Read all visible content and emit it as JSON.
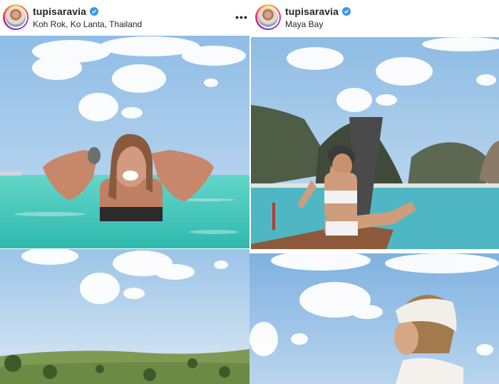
{
  "posts": [
    {
      "username": "tupisaravia",
      "location": "Koh Rok, Ko Lanta, Thailand",
      "verified": true
    },
    {
      "username": "tupisaravia",
      "location": "Maya Bay",
      "verified": true
    }
  ],
  "icons": {
    "verified": "verified-badge-icon",
    "more": "more-options-icon"
  },
  "colors": {
    "verified_blue": "#3897f0",
    "sky": "#9cc3e6",
    "sea": "#4fd0c2",
    "text": "#262626"
  }
}
